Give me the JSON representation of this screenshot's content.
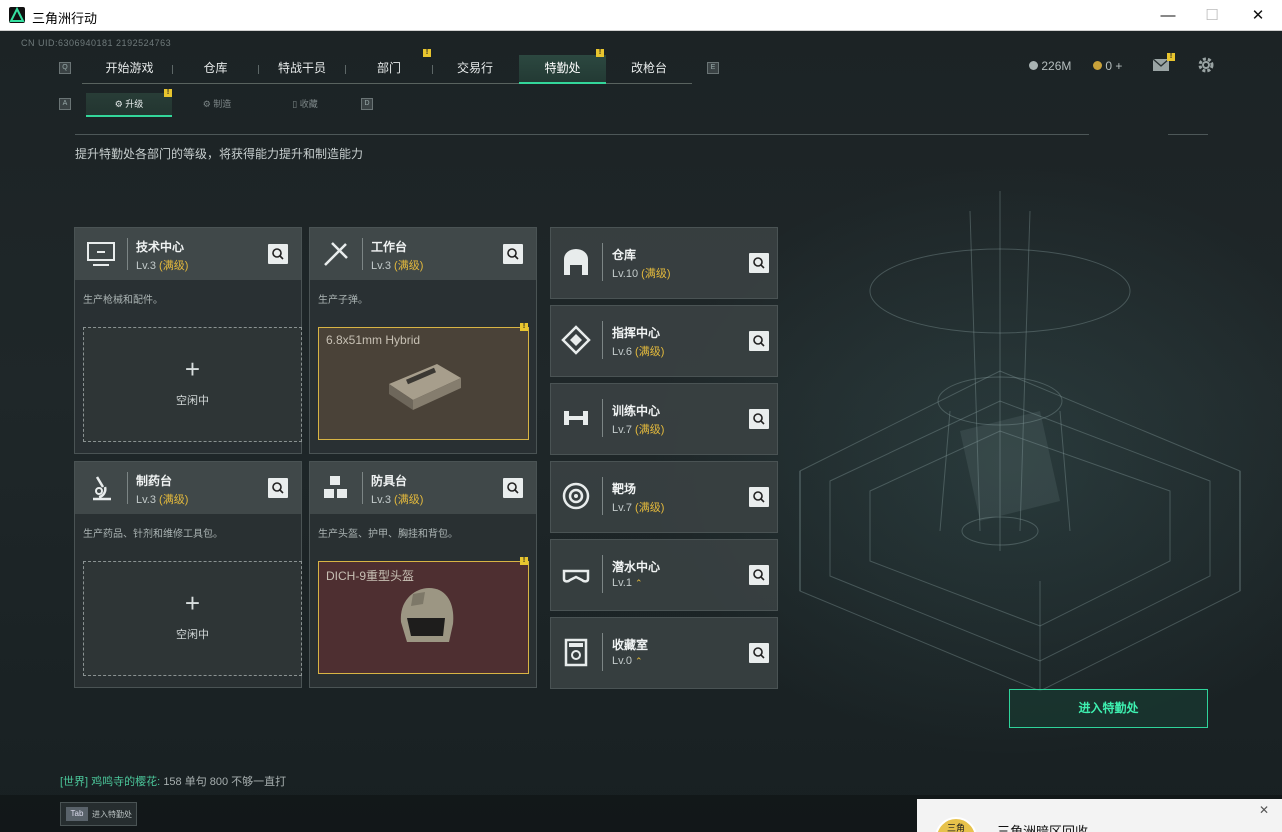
{
  "window": {
    "title": "三角洲行动"
  },
  "header": {
    "uid": "CN UID:6306940181 2192524763",
    "tabs": [
      "开始游戏",
      "仓库",
      "特战干员",
      "部门",
      "交易行",
      "特勤处",
      "改枪台"
    ],
    "key_left": "Q",
    "key_right": "E",
    "currency": "226M",
    "coins": "0",
    "plus": "+"
  },
  "subnav": {
    "items": [
      "升级",
      "制造",
      "收藏"
    ],
    "key_left": "A",
    "key_right": "D"
  },
  "description": "提升特勤处各部门的等级，将获得能力提升和制造能力",
  "cards": [
    {
      "name": "技术中心",
      "level": "Lv.3",
      "max": "(满级)",
      "desc": "生产枪械和配件。",
      "slot": {
        "plus": "+",
        "label": "空闲中"
      }
    },
    {
      "name": "工作台",
      "level": "Lv.3",
      "max": "(满级)",
      "desc": "生产子弹。",
      "product": "6.8x51mm Hybrid"
    },
    {
      "name": "制药台",
      "level": "Lv.3",
      "max": "(满级)",
      "desc": "生产药品、针剂和维修工具包。",
      "slot": {
        "plus": "+",
        "label": "空闲中"
      }
    },
    {
      "name": "防具台",
      "level": "Lv.3",
      "max": "(满级)",
      "desc": "生产头盔、护甲、胸挂和背包。",
      "product": "DICH-9重型头盔"
    }
  ],
  "rooms": [
    {
      "name": "仓库",
      "level": "Lv.10",
      "max": "(满级)"
    },
    {
      "name": "指挥中心",
      "level": "Lv.6",
      "max": "(满级)"
    },
    {
      "name": "训练中心",
      "level": "Lv.7",
      "max": "(满级)"
    },
    {
      "name": "靶场",
      "level": "Lv.7",
      "max": "(满级)"
    },
    {
      "name": "潜水中心",
      "level": "Lv.1",
      "max": "⌃"
    },
    {
      "name": "收藏室",
      "level": "Lv.0",
      "max": "⌃"
    }
  ],
  "enter_button": "进入特勤处",
  "chat": {
    "channel": "[世界]",
    "user": "鸡鸣寺的樱花:",
    "message": "158 单句 800 不够一直打"
  },
  "tab_hint": {
    "key": "Tab",
    "label": "进入特勤处"
  },
  "notification": {
    "logo": "三角",
    "text": "三角洲暗区回收"
  },
  "colors": {
    "accent": "#33d69a",
    "gold": "#e3b93c",
    "badge": "#e8c52e"
  }
}
